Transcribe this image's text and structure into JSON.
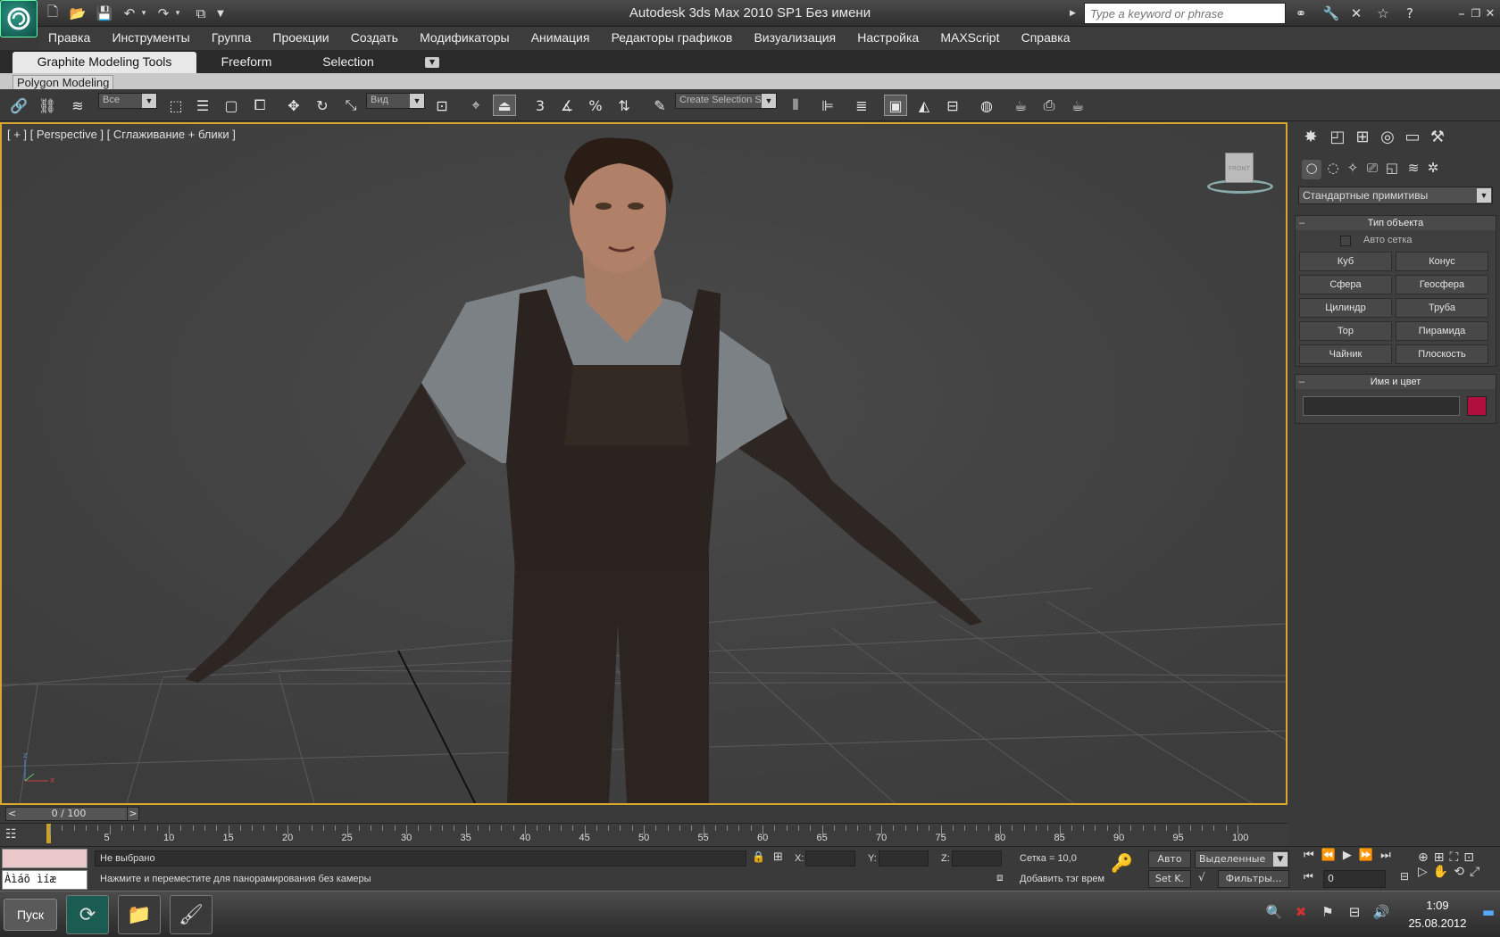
{
  "window": {
    "title": "Autodesk 3ds Max  2010 SP1       Без имени",
    "search_placeholder": "Type a keyword or phrase"
  },
  "menu": [
    "Правка",
    "Инструменты",
    "Группа",
    "Проекции",
    "Создать",
    "Модификаторы",
    "Анимация",
    "Редакторы графиков",
    "Визуализация",
    "Настройка",
    "MAXScript",
    "Справка"
  ],
  "ribbon": {
    "tabs": [
      "Graphite Modeling Tools",
      "Freeform",
      "Selection"
    ],
    "panel": "Polygon Modeling"
  },
  "toolbar": {
    "filter_dropdown": "Все",
    "view_dropdown": "Вид",
    "selection_set": "Create Selection Se",
    "snap_label": "3"
  },
  "viewport": {
    "label": "[ + ] [ Perspective ] [ Сглаживание + блики ]",
    "viewcube_label": "FRONT"
  },
  "command_panel": {
    "category": "Стандартные примитивы",
    "object_type": {
      "header": "Тип объекта",
      "autogrid": "Авто сетка",
      "buttons": [
        "Куб",
        "Конус",
        "Сфера",
        "Геосфера",
        "Цилиндр",
        "Труба",
        "Тор",
        "Пирамида",
        "Чайник",
        "Плоскость"
      ]
    },
    "name_color": {
      "header": "Имя и цвет",
      "color": "#b0103d"
    }
  },
  "timeline": {
    "frame_display": "0 / 100",
    "prev": "<",
    "next": ">",
    "ticks": [
      "5",
      "10",
      "15",
      "20",
      "25",
      "30",
      "35",
      "40",
      "45",
      "50",
      "55",
      "60",
      "65",
      "70",
      "75",
      "80",
      "85",
      "90",
      "95",
      "100"
    ]
  },
  "status": {
    "script_box": "Àìáõ ìíæ",
    "selection_status": "Не выбрано",
    "prompt": "Нажмите и переместите для панорамирования без камеры",
    "x_label": "X:",
    "y_label": "Y:",
    "z_label": "Z:",
    "grid": "Сетка = 10,0",
    "add_tag": "Добавить тэг врем",
    "auto_key": "Авто",
    "set_key": "Set K.",
    "key_filter": "Выделенные",
    "filters": "Фильтры...",
    "frame_value": "0"
  },
  "taskbar": {
    "start": "Пуск",
    "time": "1:09",
    "date": "25.08.2012"
  }
}
